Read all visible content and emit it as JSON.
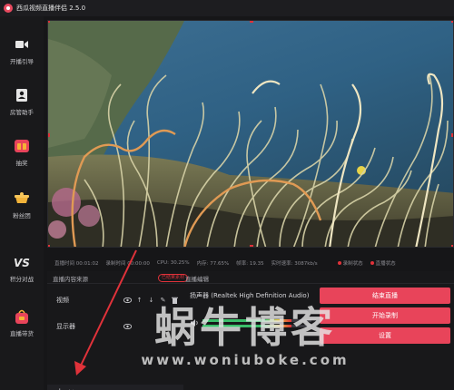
{
  "app": {
    "title": "西瓜视频直播伴侣 2.5.0"
  },
  "sidebar": {
    "items": [
      {
        "label": "开播引导",
        "icon": "video-camera-icon"
      },
      {
        "label": "房管助手",
        "icon": "user-badge-icon"
      },
      {
        "label": "抽奖",
        "icon": "lottery-gift-icon"
      },
      {
        "label": "粉丝团",
        "icon": "fan-club-icon"
      },
      {
        "label": "积分对战",
        "icon": "versus-icon"
      },
      {
        "label": "直播带货",
        "icon": "shopping-bag-icon"
      }
    ]
  },
  "status": {
    "live_time": "直播时间 00:01:02",
    "record_time": "录制时间 00:00:00",
    "cpu": "CPU: 30.25%",
    "memory": "内存: 77.65%",
    "frame_rate": "帧率: 19.35",
    "bitrate": "实时速率: 3087kb/s",
    "record_status": "录制状态",
    "live_status": "直播状态"
  },
  "tabs": {
    "content_source": "直播内容来源",
    "badge": "已结束素材",
    "live_edit": "直播编辑"
  },
  "sources": [
    {
      "name": "视频"
    },
    {
      "name": "显示器"
    }
  ],
  "add_source": "来源",
  "audio": {
    "device": "扬声器 (Realtek High Definition Audio)",
    "level": 0.82
  },
  "buttons": {
    "end_live": "结束直播",
    "start_record": "开始录制",
    "settings": "设置"
  },
  "watermark": {
    "text": "蜗牛博客",
    "url": "www.woniuboke.com"
  },
  "colors": {
    "accent": "#e8445a",
    "handle": "#e0323a",
    "background": "#161618"
  }
}
